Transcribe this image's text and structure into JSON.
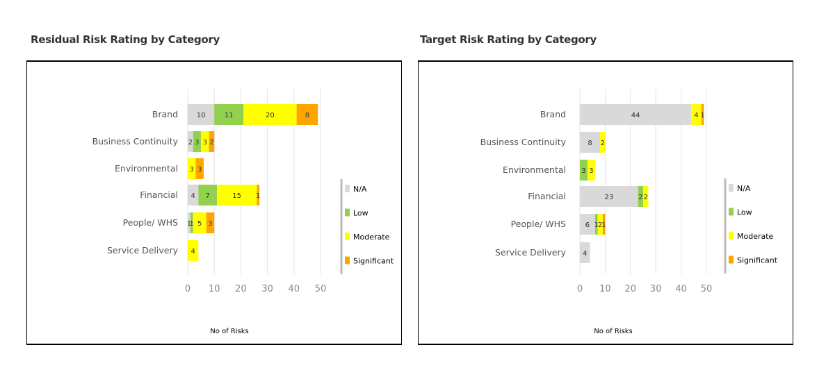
{
  "chart_data": [
    {
      "type": "bar",
      "orientation": "horizontal",
      "stacked": true,
      "title": "Residual Risk Rating by Category",
      "xlabel": "No of Risks",
      "ylabel": "",
      "xlim": [
        0,
        50
      ],
      "xticks": [
        "0",
        "10",
        "20",
        "30",
        "40",
        "50"
      ],
      "grid": true,
      "legend_position": "right",
      "categories": [
        "Brand",
        "Business Continuity",
        "Environmental",
        "Financial",
        "People/ WHS",
        "Service Delivery"
      ],
      "series": [
        {
          "name": "N/A",
          "color": "#d9d9d9",
          "values": [
            10,
            2,
            0,
            4,
            1,
            0
          ]
        },
        {
          "name": "Low",
          "color": "#92d050",
          "values": [
            11,
            3,
            0,
            7,
            1,
            0
          ]
        },
        {
          "name": "Moderate",
          "color": "#ffff00",
          "values": [
            20,
            3,
            3,
            15,
            5,
            4
          ]
        },
        {
          "name": "Significant",
          "color": "#ffa500",
          "values": [
            8,
            2,
            3,
            1,
            3,
            0
          ]
        }
      ]
    },
    {
      "type": "bar",
      "orientation": "horizontal",
      "stacked": true,
      "title": "Target Risk Rating by Category",
      "xlabel": "No of Risks",
      "ylabel": "",
      "xlim": [
        0,
        50
      ],
      "xticks": [
        "0",
        "10",
        "20",
        "30",
        "40",
        "50"
      ],
      "grid": true,
      "legend_position": "right",
      "categories": [
        "Brand",
        "Business Continuity",
        "Environmental",
        "Financial",
        "People/ WHS",
        "Service Delivery"
      ],
      "series": [
        {
          "name": "N/A",
          "color": "#d9d9d9",
          "values": [
            44,
            8,
            0,
            23,
            6,
            4
          ]
        },
        {
          "name": "Low",
          "color": "#92d050",
          "values": [
            0,
            0,
            3,
            2,
            1,
            0
          ]
        },
        {
          "name": "Moderate",
          "color": "#ffff00",
          "values": [
            4,
            2,
            3,
            2,
            2,
            0
          ]
        },
        {
          "name": "Significant",
          "color": "#ffa500",
          "values": [
            1,
            0,
            0,
            0,
            1,
            0
          ]
        }
      ]
    }
  ]
}
